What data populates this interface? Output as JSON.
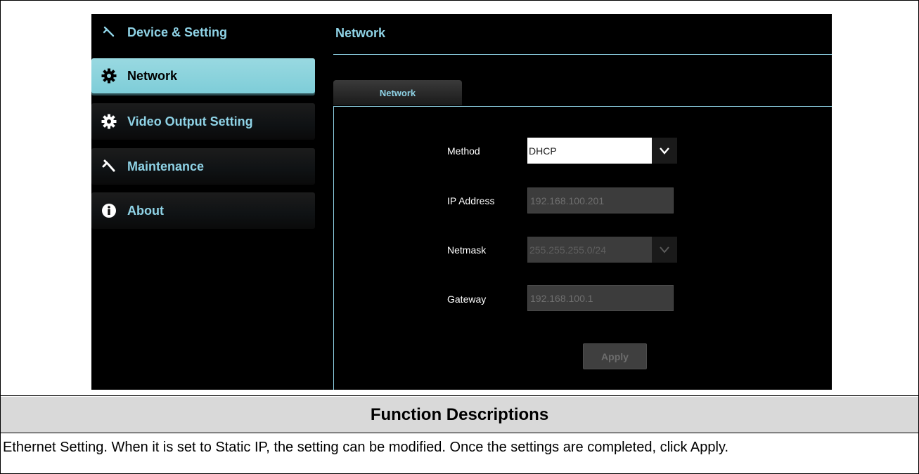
{
  "sidebar": {
    "items": [
      {
        "label": "Device & Setting",
        "icon": "wrench-icon"
      },
      {
        "label": "Network",
        "icon": "gear-icon"
      },
      {
        "label": "Video Output Setting",
        "icon": "gear-icon"
      },
      {
        "label": "Maintenance",
        "icon": "wrench-icon"
      },
      {
        "label": "About",
        "icon": "info-icon"
      }
    ],
    "active_index": 1
  },
  "main": {
    "title": "Network",
    "tab_label": "Network",
    "fields": {
      "method_label": "Method",
      "method_value": "DHCP",
      "ip_label": "IP Address",
      "ip_value": "192.168.100.201",
      "netmask_label": "Netmask",
      "netmask_value": "255.255.255.0/24",
      "gateway_label": "Gateway",
      "gateway_value": "192.168.100.1"
    },
    "apply_label": "Apply"
  },
  "description": {
    "heading": "Function Descriptions",
    "text": "Ethernet Setting. When it is set to Static IP, the setting can be modified. Once the settings are completed, click Apply."
  },
  "colors": {
    "accent": "#8fd3e6",
    "active_bg": "#8fd1db",
    "ui_bg": "#000000",
    "disabled_field": "#3c3c3c",
    "table_header": "#d9d9d9"
  }
}
